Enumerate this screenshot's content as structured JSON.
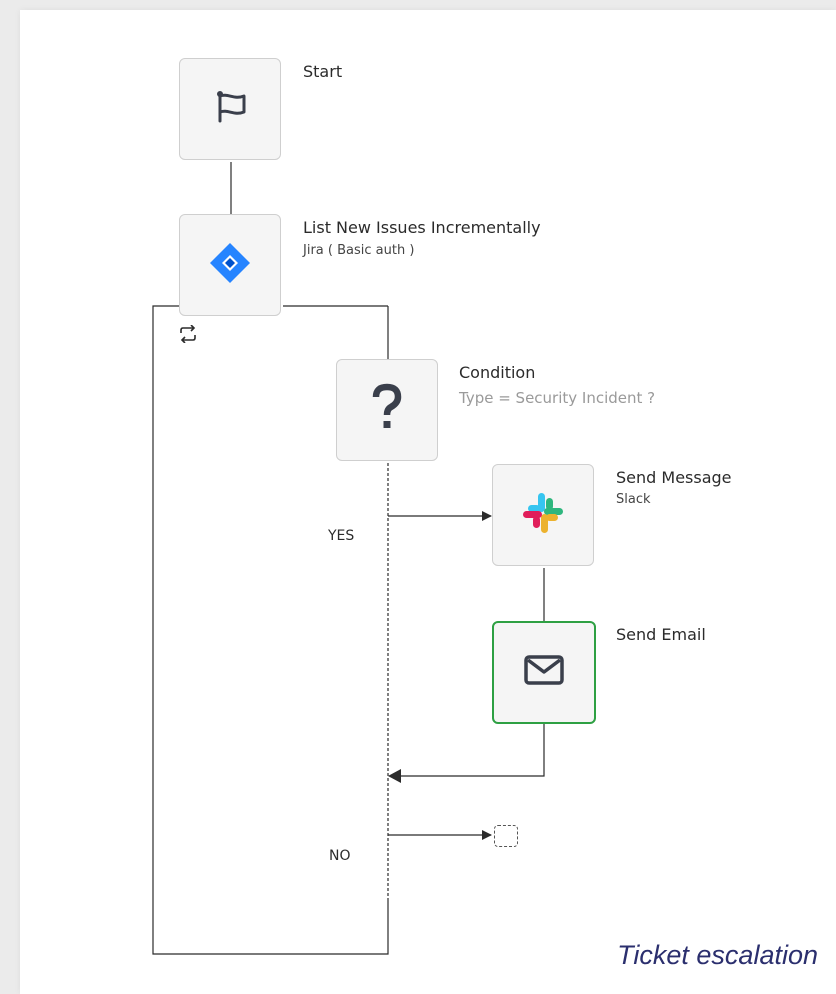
{
  "workflow": {
    "steps": [
      {
        "id": "start",
        "title": "Start",
        "subtitle": "",
        "icon": "flag-icon"
      },
      {
        "id": "jira",
        "title": "List New Issues Incrementally",
        "subtitle": "Jira ( Basic auth )",
        "icon": "jira-icon"
      },
      {
        "id": "condition",
        "title": "Condition",
        "subtitle": "Type = Security Incident ?",
        "icon": "question-mark-icon"
      },
      {
        "id": "slack",
        "title": "Send Message",
        "subtitle": "Slack",
        "icon": "slack-icon"
      },
      {
        "id": "email",
        "title": "Send Email",
        "subtitle": "",
        "icon": "envelope-icon"
      }
    ],
    "branches": {
      "yes_label": "YES",
      "no_label": "NO"
    },
    "loop_icon": "loop-icon"
  },
  "caption": "Ticket escalation",
  "colors": {
    "selected_border": "#2ea043",
    "jira_blue": "#2684ff",
    "slack_blue": "#36c5f0",
    "slack_green": "#2eb67d",
    "slack_red": "#e01e5a",
    "slack_yellow": "#ecb22e",
    "caption_text": "#2b2f6e"
  }
}
